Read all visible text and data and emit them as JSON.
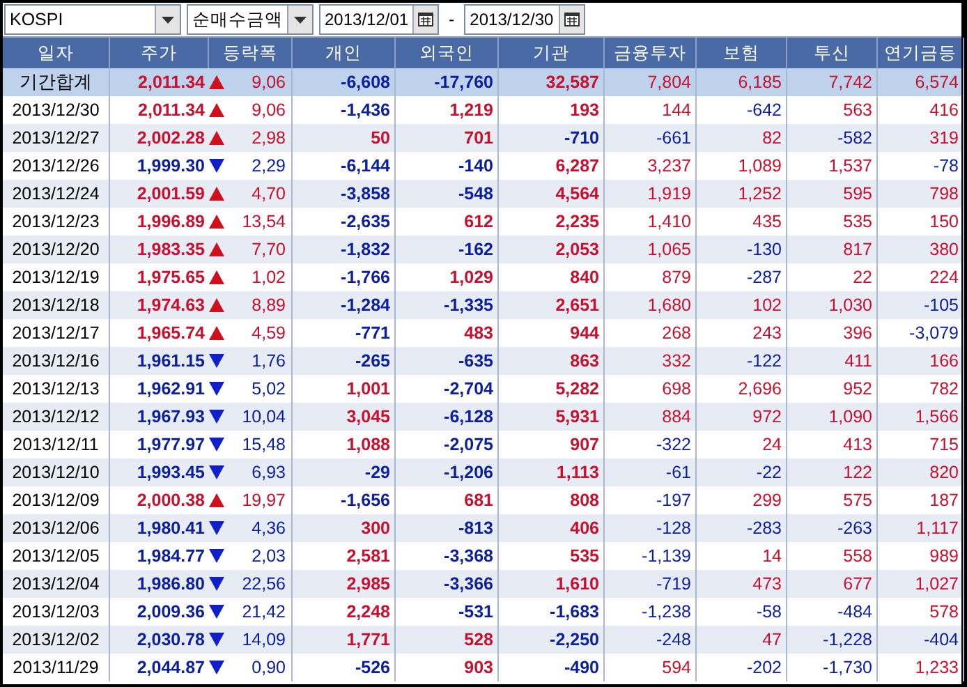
{
  "toolbar": {
    "market": "KOSPI",
    "measure": "순매수금액",
    "date_from": "2013/12/01",
    "separator": "-",
    "date_to": "2013/12/30"
  },
  "table": {
    "columns": [
      "일자",
      "주가",
      "등락폭",
      "개인",
      "외국인",
      "기관",
      "금융투자",
      "보험",
      "투신",
      "연기금등"
    ],
    "rows": [
      {
        "kind": "total",
        "date": "기간합계",
        "price": "2,011.34",
        "rising": true,
        "change": "9,06",
        "flows": [
          "-6,608",
          "-17,760",
          "32,587",
          "7,804",
          "6,185",
          "7,742",
          "6,574"
        ]
      },
      {
        "kind": "day",
        "date": "2013/12/30",
        "price": "2,011.34",
        "rising": true,
        "change": "9,06",
        "flows": [
          "-1,436",
          "1,219",
          "193",
          "144",
          "-642",
          "563",
          "416"
        ]
      },
      {
        "kind": "day",
        "date": "2013/12/27",
        "price": "2,002.28",
        "rising": true,
        "change": "2,98",
        "flows": [
          "50",
          "701",
          "-710",
          "-661",
          "82",
          "-582",
          "319"
        ]
      },
      {
        "kind": "day",
        "date": "2013/12/26",
        "price": "1,999.30",
        "rising": false,
        "change": "2,29",
        "flows": [
          "-6,144",
          "-140",
          "6,287",
          "3,237",
          "1,089",
          "1,537",
          "-78"
        ]
      },
      {
        "kind": "day",
        "date": "2013/12/24",
        "price": "2,001.59",
        "rising": true,
        "change": "4,70",
        "flows": [
          "-3,858",
          "-548",
          "4,564",
          "1,919",
          "1,252",
          "595",
          "798"
        ]
      },
      {
        "kind": "day",
        "date": "2013/12/23",
        "price": "1,996.89",
        "rising": true,
        "change": "13,54",
        "flows": [
          "-2,635",
          "612",
          "2,235",
          "1,410",
          "435",
          "535",
          "150"
        ]
      },
      {
        "kind": "day",
        "date": "2013/12/20",
        "price": "1,983.35",
        "rising": true,
        "change": "7,70",
        "flows": [
          "-1,832",
          "-162",
          "2,053",
          "1,065",
          "-130",
          "817",
          "380"
        ]
      },
      {
        "kind": "day",
        "date": "2013/12/19",
        "price": "1,975.65",
        "rising": true,
        "change": "1,02",
        "flows": [
          "-1,766",
          "1,029",
          "840",
          "879",
          "-287",
          "22",
          "224"
        ]
      },
      {
        "kind": "day",
        "date": "2013/12/18",
        "price": "1,974.63",
        "rising": true,
        "change": "8,89",
        "flows": [
          "-1,284",
          "-1,335",
          "2,651",
          "1,680",
          "102",
          "1,030",
          "-105"
        ]
      },
      {
        "kind": "day",
        "date": "2013/12/17",
        "price": "1,965.74",
        "rising": true,
        "change": "4,59",
        "flows": [
          "-771",
          "483",
          "944",
          "268",
          "243",
          "396",
          "-3,079"
        ]
      },
      {
        "kind": "day",
        "date": "2013/12/16",
        "price": "1,961.15",
        "rising": false,
        "change": "1,76",
        "flows": [
          "-265",
          "-635",
          "863",
          "332",
          "-122",
          "411",
          "166"
        ]
      },
      {
        "kind": "day",
        "date": "2013/12/13",
        "price": "1,962.91",
        "rising": false,
        "change": "5,02",
        "flows": [
          "1,001",
          "-2,704",
          "5,282",
          "698",
          "2,696",
          "952",
          "782"
        ]
      },
      {
        "kind": "day",
        "date": "2013/12/12",
        "price": "1,967.93",
        "rising": false,
        "change": "10,04",
        "flows": [
          "3,045",
          "-6,128",
          "5,931",
          "884",
          "972",
          "1,090",
          "1,566"
        ]
      },
      {
        "kind": "day",
        "date": "2013/12/11",
        "price": "1,977.97",
        "rising": false,
        "change": "15,48",
        "flows": [
          "1,088",
          "-2,075",
          "907",
          "-322",
          "24",
          "413",
          "715"
        ]
      },
      {
        "kind": "day",
        "date": "2013/12/10",
        "price": "1,993.45",
        "rising": false,
        "change": "6,93",
        "flows": [
          "-29",
          "-1,206",
          "1,113",
          "-61",
          "-22",
          "122",
          "820"
        ]
      },
      {
        "kind": "day",
        "date": "2013/12/09",
        "price": "2,000.38",
        "rising": true,
        "change": "19,97",
        "flows": [
          "-1,656",
          "681",
          "808",
          "-197",
          "299",
          "575",
          "187"
        ]
      },
      {
        "kind": "day",
        "date": "2013/12/06",
        "price": "1,980.41",
        "rising": false,
        "change": "4,36",
        "flows": [
          "300",
          "-813",
          "406",
          "-128",
          "-283",
          "-263",
          "1,117"
        ]
      },
      {
        "kind": "day",
        "date": "2013/12/05",
        "price": "1,984.77",
        "rising": false,
        "change": "2,03",
        "flows": [
          "2,581",
          "-3,368",
          "535",
          "-1,139",
          "14",
          "558",
          "989"
        ]
      },
      {
        "kind": "day",
        "date": "2013/12/04",
        "price": "1,986.80",
        "rising": false,
        "change": "22,56",
        "flows": [
          "2,985",
          "-3,366",
          "1,610",
          "-719",
          "473",
          "677",
          "1,027"
        ]
      },
      {
        "kind": "day",
        "date": "2013/12/03",
        "price": "2,009.36",
        "rising": false,
        "change": "21,42",
        "flows": [
          "2,248",
          "-531",
          "-1,683",
          "-1,238",
          "-58",
          "-484",
          "578"
        ]
      },
      {
        "kind": "day",
        "date": "2013/12/02",
        "price": "2,030.78",
        "rising": false,
        "change": "14,09",
        "flows": [
          "1,771",
          "528",
          "-2,250",
          "-248",
          "47",
          "-1,228",
          "-404"
        ]
      },
      {
        "kind": "day",
        "date": "2013/11/29",
        "price": "2,044.87",
        "rising": false,
        "change": "0,90",
        "flows": [
          "-526",
          "903",
          "-490",
          "594",
          "-202",
          "-1,730",
          "1,233"
        ]
      }
    ]
  }
}
